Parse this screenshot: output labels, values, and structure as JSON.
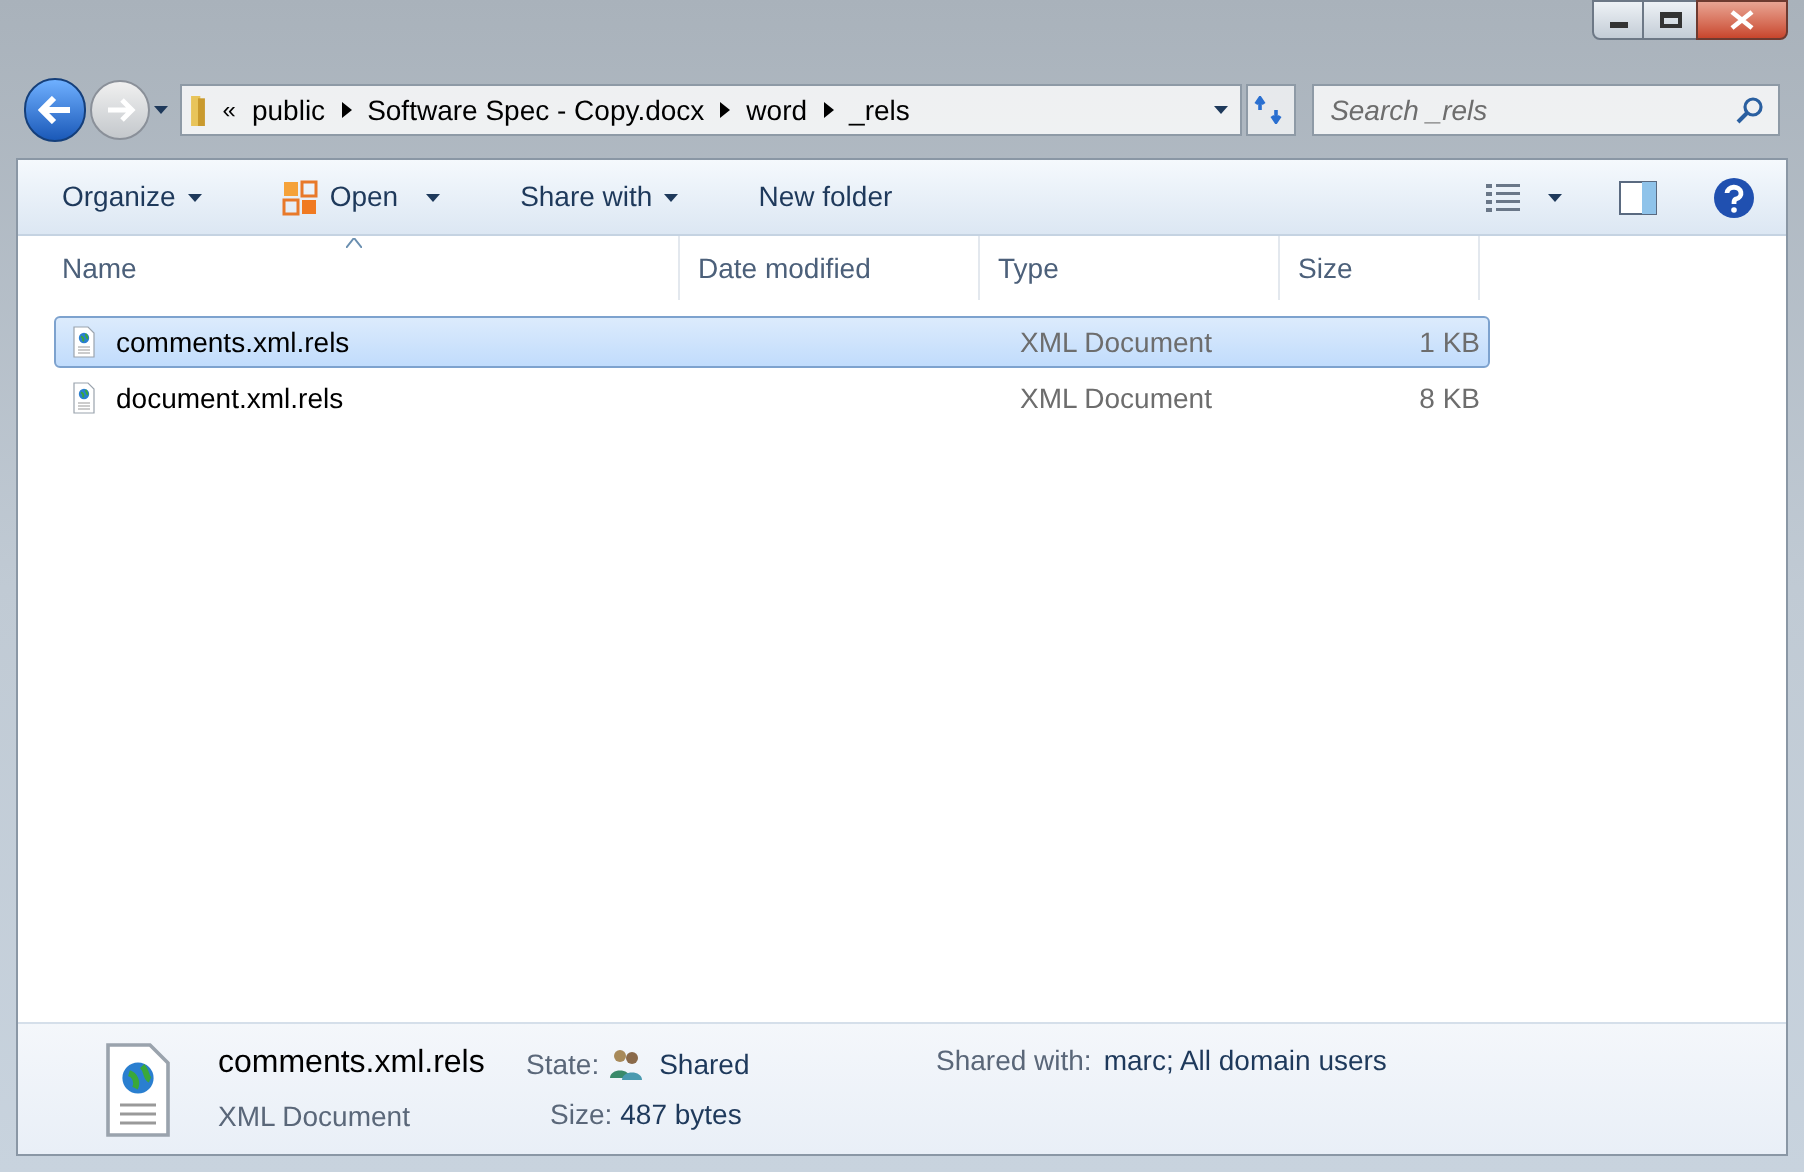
{
  "address": {
    "overflow": "«",
    "crumbs": [
      "public",
      "Software Spec - Copy.docx",
      "word",
      "_rels"
    ]
  },
  "search": {
    "placeholder": "Search _rels"
  },
  "toolbar": [
    {
      "label": "Organize",
      "kind": "menu"
    },
    {
      "label": "Open",
      "kind": "open"
    },
    {
      "label": "Share with",
      "kind": "menu"
    },
    {
      "label": "New folder",
      "kind": "plain"
    }
  ],
  "columns": [
    "Name",
    "Date modified",
    "Type",
    "Size"
  ],
  "rows": [
    {
      "name": "comments.xml.rels",
      "date": "",
      "type": "XML Document",
      "size": "1 KB",
      "selected": true
    },
    {
      "name": "document.xml.rels",
      "date": "",
      "type": "XML Document",
      "size": "8 KB",
      "selected": false
    }
  ],
  "details": {
    "name": "comments.xml.rels",
    "type": "XML Document",
    "state_label": "State:",
    "state": "Shared",
    "size_label": "Size:",
    "size": "487 bytes",
    "shared_label": "Shared with:",
    "shared": "marc; All domain users"
  }
}
